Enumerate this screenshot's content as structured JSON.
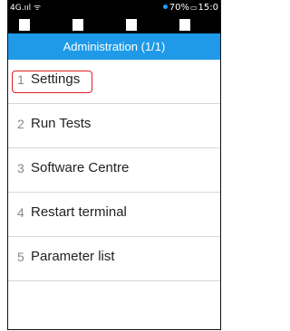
{
  "status_bar": {
    "network": "4G",
    "battery": "70%",
    "time": "15:0",
    "colors": {
      "background": "#000000",
      "bluetooth_dot": "#1da1ff"
    }
  },
  "header": {
    "title": "Administration (1/1)",
    "color": "#1e9ae9"
  },
  "menu": {
    "items": [
      {
        "number": "1",
        "label": "Settings",
        "selected": true
      },
      {
        "number": "2",
        "label": "Run Tests"
      },
      {
        "number": "3",
        "label": "Software Centre"
      },
      {
        "number": "4",
        "label": "Restart terminal"
      },
      {
        "number": "5",
        "label": "Parameter list"
      }
    ],
    "highlight_color": "#e02020"
  }
}
